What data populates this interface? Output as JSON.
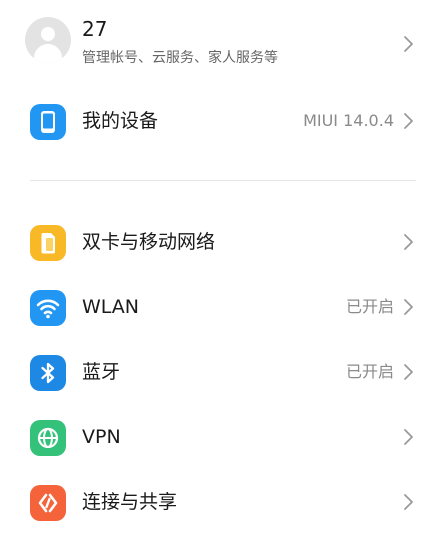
{
  "account": {
    "name": "27",
    "subtitle": "管理帐号、云服务、家人服务等",
    "icon": "avatar-icon"
  },
  "device": {
    "label": "我的设备",
    "value": "MIUI 14.0.4",
    "icon": "phone-icon",
    "color": "#2196F3"
  },
  "network": [
    {
      "label": "双卡与移动网络",
      "value": "",
      "icon": "sim-card-icon",
      "color": "#F9B826"
    },
    {
      "label": "WLAN",
      "value": "已开启",
      "icon": "wifi-icon",
      "color": "#2196F3"
    },
    {
      "label": "蓝牙",
      "value": "已开启",
      "icon": "bluetooth-icon",
      "color": "#1E88E5"
    },
    {
      "label": "VPN",
      "value": "",
      "icon": "globe-icon",
      "color": "#34C27B"
    },
    {
      "label": "连接与共享",
      "value": "",
      "icon": "connection-share-icon",
      "color": "#F4633A"
    }
  ]
}
